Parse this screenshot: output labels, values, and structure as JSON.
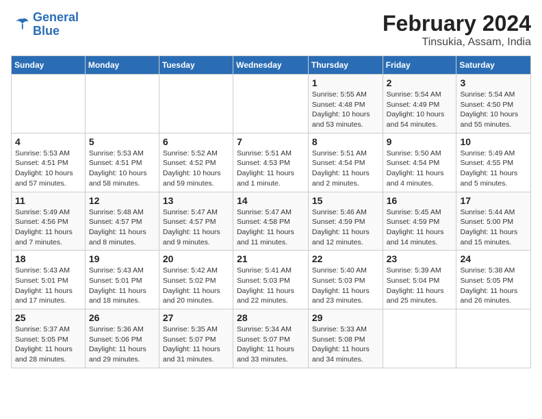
{
  "header": {
    "logo_line1": "General",
    "logo_line2": "Blue",
    "title": "February 2024",
    "subtitle": "Tinsukia, Assam, India"
  },
  "days_of_week": [
    "Sunday",
    "Monday",
    "Tuesday",
    "Wednesday",
    "Thursday",
    "Friday",
    "Saturday"
  ],
  "weeks": [
    [
      {
        "day": "",
        "info": ""
      },
      {
        "day": "",
        "info": ""
      },
      {
        "day": "",
        "info": ""
      },
      {
        "day": "",
        "info": ""
      },
      {
        "day": "1",
        "info": "Sunrise: 5:55 AM\nSunset: 4:48 PM\nDaylight: 10 hours and 53 minutes."
      },
      {
        "day": "2",
        "info": "Sunrise: 5:54 AM\nSunset: 4:49 PM\nDaylight: 10 hours and 54 minutes."
      },
      {
        "day": "3",
        "info": "Sunrise: 5:54 AM\nSunset: 4:50 PM\nDaylight: 10 hours and 55 minutes."
      }
    ],
    [
      {
        "day": "4",
        "info": "Sunrise: 5:53 AM\nSunset: 4:51 PM\nDaylight: 10 hours and 57 minutes."
      },
      {
        "day": "5",
        "info": "Sunrise: 5:53 AM\nSunset: 4:51 PM\nDaylight: 10 hours and 58 minutes."
      },
      {
        "day": "6",
        "info": "Sunrise: 5:52 AM\nSunset: 4:52 PM\nDaylight: 10 hours and 59 minutes."
      },
      {
        "day": "7",
        "info": "Sunrise: 5:51 AM\nSunset: 4:53 PM\nDaylight: 11 hours and 1 minute."
      },
      {
        "day": "8",
        "info": "Sunrise: 5:51 AM\nSunset: 4:54 PM\nDaylight: 11 hours and 2 minutes."
      },
      {
        "day": "9",
        "info": "Sunrise: 5:50 AM\nSunset: 4:54 PM\nDaylight: 11 hours and 4 minutes."
      },
      {
        "day": "10",
        "info": "Sunrise: 5:49 AM\nSunset: 4:55 PM\nDaylight: 11 hours and 5 minutes."
      }
    ],
    [
      {
        "day": "11",
        "info": "Sunrise: 5:49 AM\nSunset: 4:56 PM\nDaylight: 11 hours and 7 minutes."
      },
      {
        "day": "12",
        "info": "Sunrise: 5:48 AM\nSunset: 4:57 PM\nDaylight: 11 hours and 8 minutes."
      },
      {
        "day": "13",
        "info": "Sunrise: 5:47 AM\nSunset: 4:57 PM\nDaylight: 11 hours and 9 minutes."
      },
      {
        "day": "14",
        "info": "Sunrise: 5:47 AM\nSunset: 4:58 PM\nDaylight: 11 hours and 11 minutes."
      },
      {
        "day": "15",
        "info": "Sunrise: 5:46 AM\nSunset: 4:59 PM\nDaylight: 11 hours and 12 minutes."
      },
      {
        "day": "16",
        "info": "Sunrise: 5:45 AM\nSunset: 4:59 PM\nDaylight: 11 hours and 14 minutes."
      },
      {
        "day": "17",
        "info": "Sunrise: 5:44 AM\nSunset: 5:00 PM\nDaylight: 11 hours and 15 minutes."
      }
    ],
    [
      {
        "day": "18",
        "info": "Sunrise: 5:43 AM\nSunset: 5:01 PM\nDaylight: 11 hours and 17 minutes."
      },
      {
        "day": "19",
        "info": "Sunrise: 5:43 AM\nSunset: 5:01 PM\nDaylight: 11 hours and 18 minutes."
      },
      {
        "day": "20",
        "info": "Sunrise: 5:42 AM\nSunset: 5:02 PM\nDaylight: 11 hours and 20 minutes."
      },
      {
        "day": "21",
        "info": "Sunrise: 5:41 AM\nSunset: 5:03 PM\nDaylight: 11 hours and 22 minutes."
      },
      {
        "day": "22",
        "info": "Sunrise: 5:40 AM\nSunset: 5:03 PM\nDaylight: 11 hours and 23 minutes."
      },
      {
        "day": "23",
        "info": "Sunrise: 5:39 AM\nSunset: 5:04 PM\nDaylight: 11 hours and 25 minutes."
      },
      {
        "day": "24",
        "info": "Sunrise: 5:38 AM\nSunset: 5:05 PM\nDaylight: 11 hours and 26 minutes."
      }
    ],
    [
      {
        "day": "25",
        "info": "Sunrise: 5:37 AM\nSunset: 5:05 PM\nDaylight: 11 hours and 28 minutes."
      },
      {
        "day": "26",
        "info": "Sunrise: 5:36 AM\nSunset: 5:06 PM\nDaylight: 11 hours and 29 minutes."
      },
      {
        "day": "27",
        "info": "Sunrise: 5:35 AM\nSunset: 5:07 PM\nDaylight: 11 hours and 31 minutes."
      },
      {
        "day": "28",
        "info": "Sunrise: 5:34 AM\nSunset: 5:07 PM\nDaylight: 11 hours and 33 minutes."
      },
      {
        "day": "29",
        "info": "Sunrise: 5:33 AM\nSunset: 5:08 PM\nDaylight: 11 hours and 34 minutes."
      },
      {
        "day": "",
        "info": ""
      },
      {
        "day": "",
        "info": ""
      }
    ]
  ]
}
